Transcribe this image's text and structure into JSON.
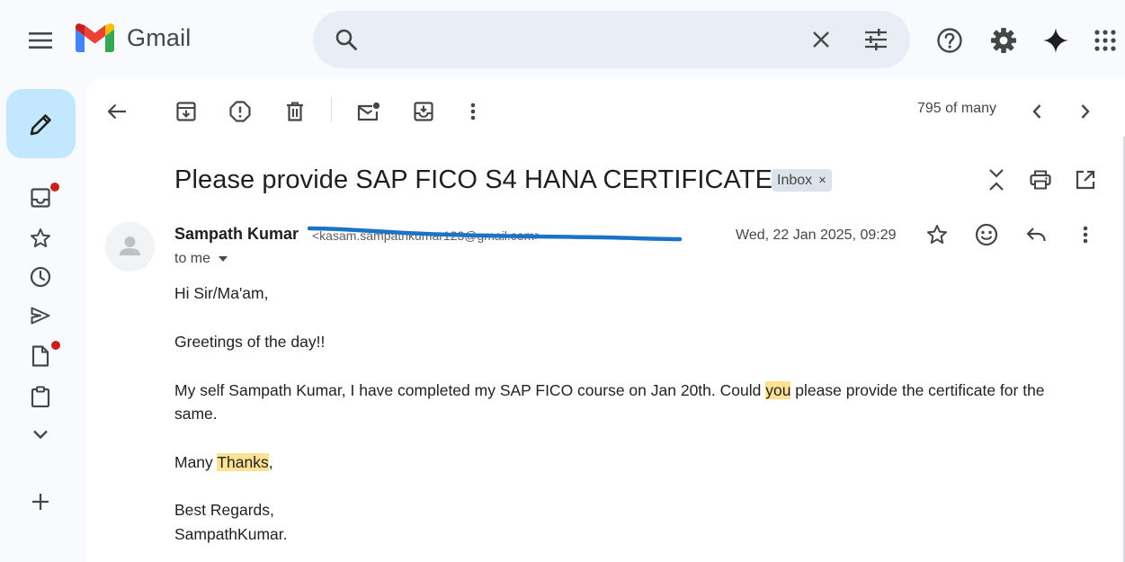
{
  "app": {
    "logo_text": "Gmail"
  },
  "search": {
    "placeholder": "",
    "value": ""
  },
  "toolbar": {
    "count": "795 of many"
  },
  "message": {
    "subject": "Please provide SAP FICO S4 HANA CERTIFICATE",
    "label": "Inbox",
    "label_remove": "×",
    "sender_name": "Sampath Kumar",
    "sender_email": "<kasam.sampathkumar123@gmail.com>",
    "recipient": "to me",
    "date": "Wed, 22 Jan 2025, 09:29",
    "body": {
      "greeting": "Hi Sir/Ma'am,",
      "line2": "Greetings of the day!!",
      "para_a": "My self Sampath Kumar, I have completed my SAP FICO course on Jan 20th. Could ",
      "para_hl": "you",
      "para_b": " please provide the certificate for the",
      "para_c": "same.",
      "thanks_a": "Many ",
      "thanks_hl": "Thanks",
      "thanks_b": ",",
      "regards": "Best Regards,",
      "signature": "SampathKumar."
    }
  },
  "colors": {
    "accent": "#c2e7ff",
    "search_bg": "#e9eef6",
    "highlight": "#fde293",
    "notification_dot": "#c5221f",
    "scribble": "#1a73c8"
  },
  "icons": {
    "top": [
      "menu-icon",
      "gmail-logo-icon",
      "search-icon",
      "clear-icon",
      "search-options-icon",
      "help-icon",
      "settings-icon",
      "gemini-icon",
      "apps-icon"
    ],
    "rail": [
      "compose-pencil-icon",
      "inbox-icon",
      "star-icon",
      "clock-icon",
      "send-icon",
      "file-icon",
      "clipboard-icon",
      "chevron-down-icon",
      "plus-icon"
    ],
    "toolbar": [
      "back-arrow-icon",
      "archive-icon",
      "report-spam-icon",
      "delete-icon",
      "mark-unread-icon",
      "move-to-icon",
      "more-vert-icon",
      "chevron-left-icon",
      "chevron-right-icon"
    ],
    "message": [
      "collapse-all-icon",
      "print-icon",
      "open-new-window-icon",
      "star-icon",
      "emoji-icon",
      "reply-icon",
      "more-vert-icon"
    ]
  }
}
